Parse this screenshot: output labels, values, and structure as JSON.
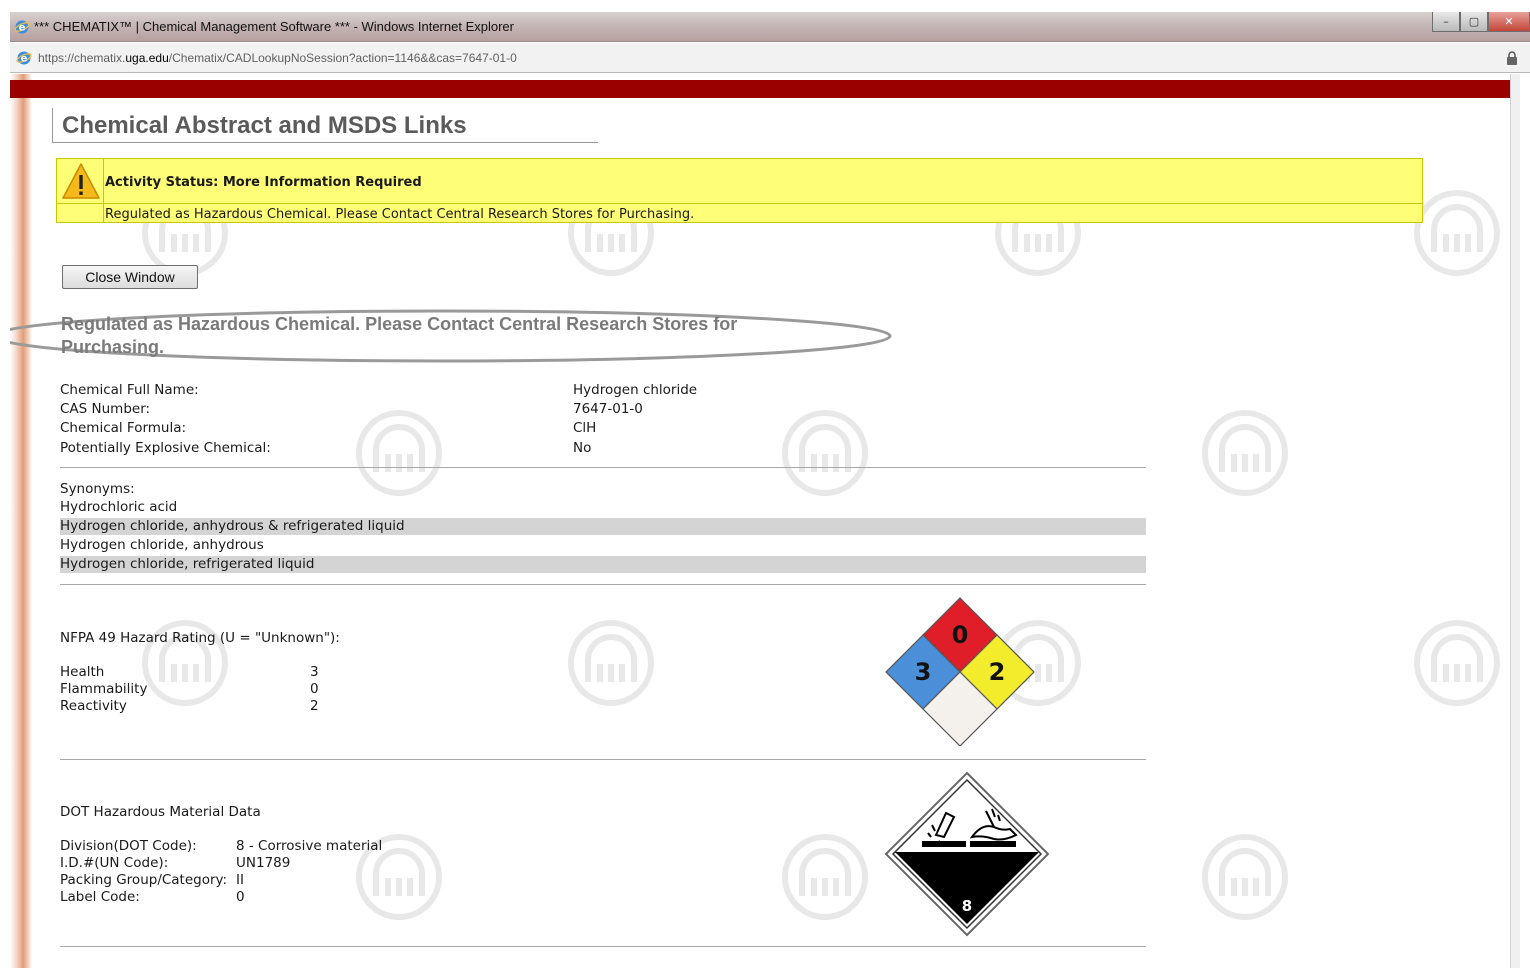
{
  "window": {
    "title": "*** CHEMATIX™ | Chemical Management Software *** - Windows Internet Explorer",
    "minimize": "–",
    "maximize": "▢",
    "close": "✕"
  },
  "address": {
    "url_prefix": "https://chematix.",
    "url_host": "uga.edu",
    "url_path": "/Chematix/CADLookupNoSession?action=1146&&cas=7647-01-0"
  },
  "page": {
    "title": "Chemical Abstract and MSDS Links",
    "alert_status": "Activity Status: More Information Required",
    "alert_message": "Regulated as Hazardous Chemical. Please Contact Central Research Stores for Purchasing.",
    "close_button": "Close Window",
    "notice": "Regulated as Hazardous Chemical. Please Contact Central Research Stores for Purchasing."
  },
  "chemical": {
    "labels": [
      "Chemical Full Name:",
      "CAS Number:",
      "Chemical Formula:",
      "Potentially Explosive Chemical:"
    ],
    "values": [
      "Hydrogen chloride",
      "7647-01-0",
      "ClH",
      "No"
    ]
  },
  "synonyms": {
    "heading": "Synonyms:",
    "items": [
      "Hydrochloric acid",
      "Hydrogen chloride, anhydrous & refrigerated liquid",
      "Hydrogen chloride, anhydrous",
      "Hydrogen chloride, refrigerated liquid"
    ]
  },
  "nfpa": {
    "heading": "NFPA 49 Hazard Rating (U = \"Unknown\"):",
    "labels": [
      "Health",
      "Flammability",
      "Reactivity"
    ],
    "values": [
      "3",
      "0",
      "2"
    ],
    "diamond": {
      "flammability": "0",
      "health": "3",
      "reactivity": "2",
      "special": ""
    },
    "colors": {
      "flammability": "#e01e2a",
      "health": "#4a8fd8",
      "reactivity": "#f3ec2c",
      "special": "#f4f1ed"
    }
  },
  "dot": {
    "heading": "DOT Hazardous Material Data",
    "labels": [
      "Division(DOT Code):",
      "I.D.#(UN Code):",
      "Packing Group/Category:",
      "Label Code:"
    ],
    "values": [
      "8 - Corrosive material",
      "UN1789",
      "II",
      "0"
    ],
    "placard_number": "8"
  },
  "colors": {
    "red_band": "#990000",
    "alert_bg": "#ffff77"
  }
}
